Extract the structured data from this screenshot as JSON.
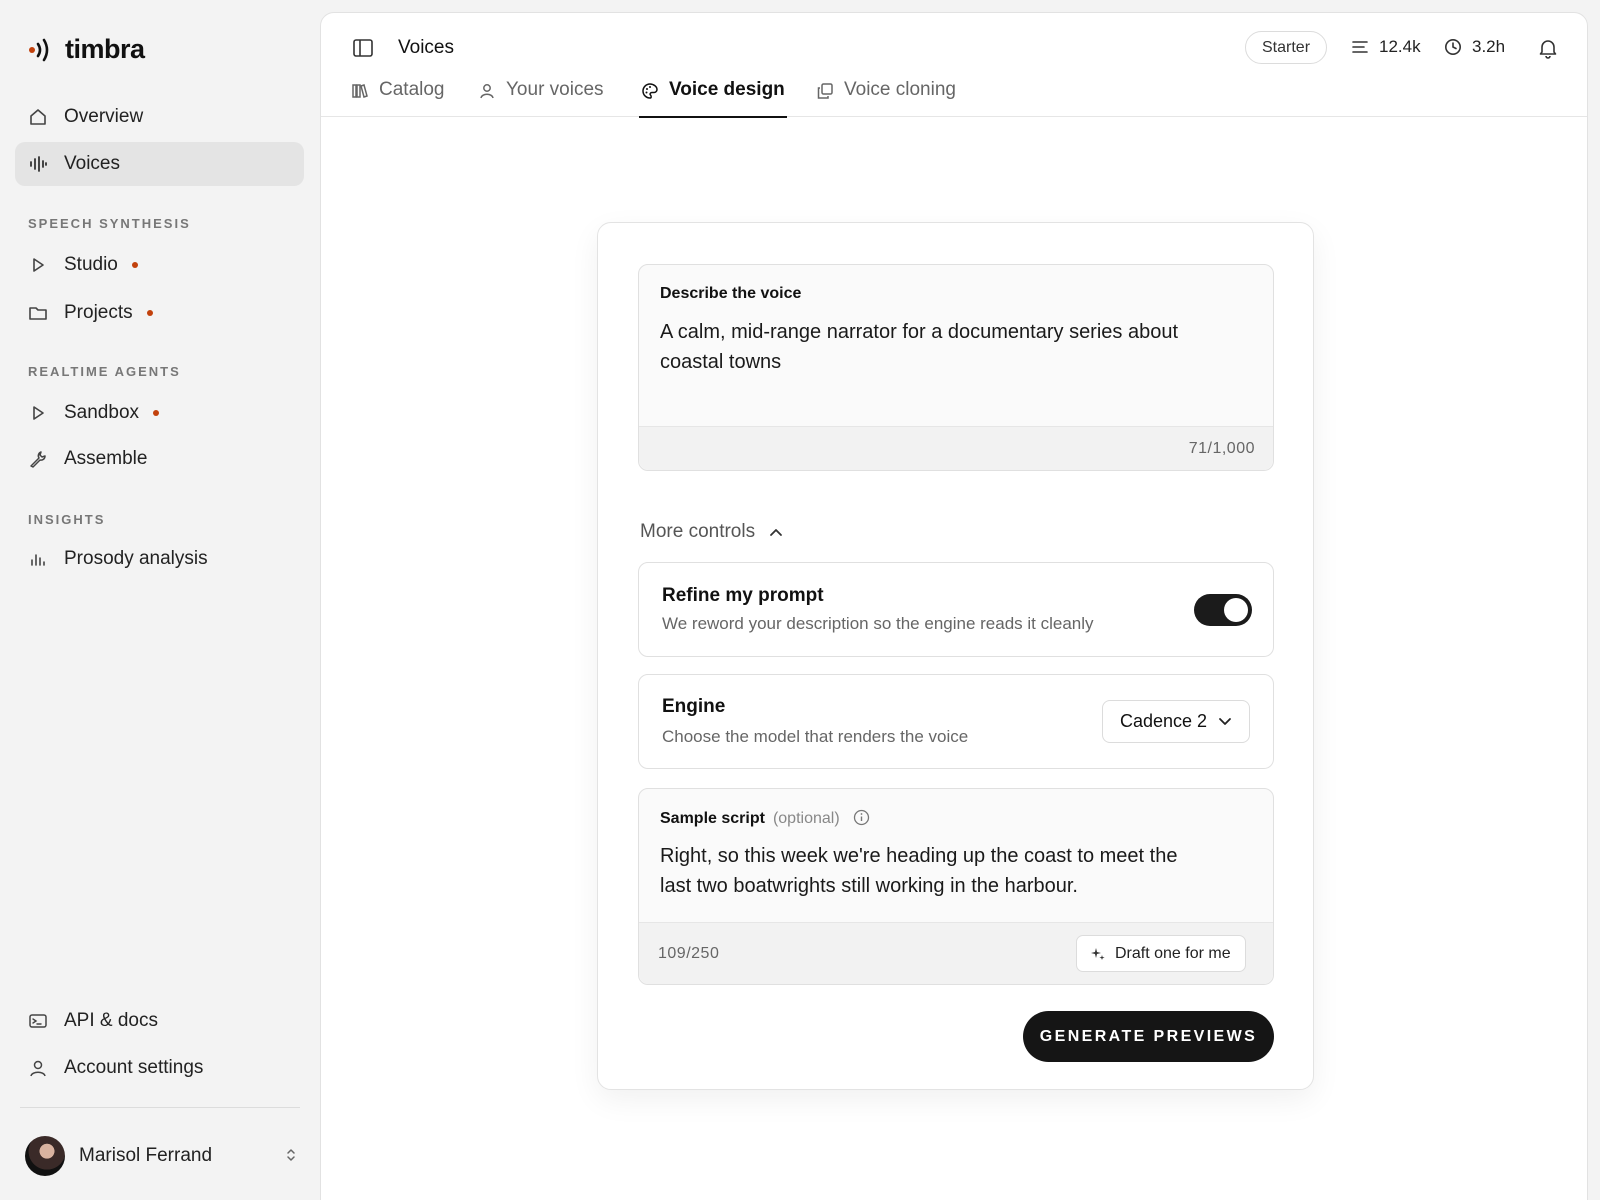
{
  "brand": {
    "name": "timbra",
    "accent": "#c2410c"
  },
  "sidebar": {
    "primary": [
      {
        "label": "Overview",
        "icon": "home-icon"
      },
      {
        "label": "Voices",
        "icon": "waveform-icon",
        "active": true
      }
    ],
    "sections": [
      {
        "label": "SPEECH SYNTHESIS",
        "items": [
          {
            "label": "Studio",
            "icon": "play-icon",
            "dot": true
          },
          {
            "label": "Projects",
            "icon": "folder-icon",
            "dot": true
          }
        ]
      },
      {
        "label": "REALTIME AGENTS",
        "items": [
          {
            "label": "Sandbox",
            "icon": "play-icon",
            "dot": true
          },
          {
            "label": "Assemble",
            "icon": "wrench-icon"
          }
        ]
      },
      {
        "label": "INSIGHTS",
        "items": [
          {
            "label": "Prosody analysis",
            "icon": "bar-chart-icon"
          }
        ]
      }
    ],
    "footer": [
      {
        "label": "API & docs",
        "icon": "terminal-icon"
      },
      {
        "label": "Account settings",
        "icon": "user-icon"
      }
    ],
    "user": {
      "name": "Marisol Ferrand"
    }
  },
  "header": {
    "title": "Voices",
    "plan": "Starter",
    "characters": "12.4k",
    "hours": "3.2h"
  },
  "tabs": [
    {
      "label": "Catalog",
      "icon": "library-icon"
    },
    {
      "label": "Your voices",
      "icon": "user-icon"
    },
    {
      "label": "Voice design",
      "icon": "palette-icon",
      "active": true
    },
    {
      "label": "Voice cloning",
      "icon": "copy-icon"
    }
  ],
  "form": {
    "describe_label": "Describe the voice",
    "describe_value": "A calm, mid-range narrator for a documentary series about coastal towns",
    "describe_count": "71/1,000",
    "more_controls": "More controls",
    "refine": {
      "title": "Refine my prompt",
      "desc": "We reword your description so the engine reads it cleanly",
      "on": true
    },
    "engine": {
      "title": "Engine",
      "desc": "Choose the model that renders the voice",
      "value": "Cadence 2"
    },
    "sample": {
      "label": "Sample script",
      "optional": "(optional)",
      "value": "Right, so this week we're heading up the coast to meet the last two boatwrights still working in the harbour.",
      "count": "109/250",
      "draft_label": "Draft one for me"
    },
    "generate_label": "GENERATE PREVIEWS"
  }
}
